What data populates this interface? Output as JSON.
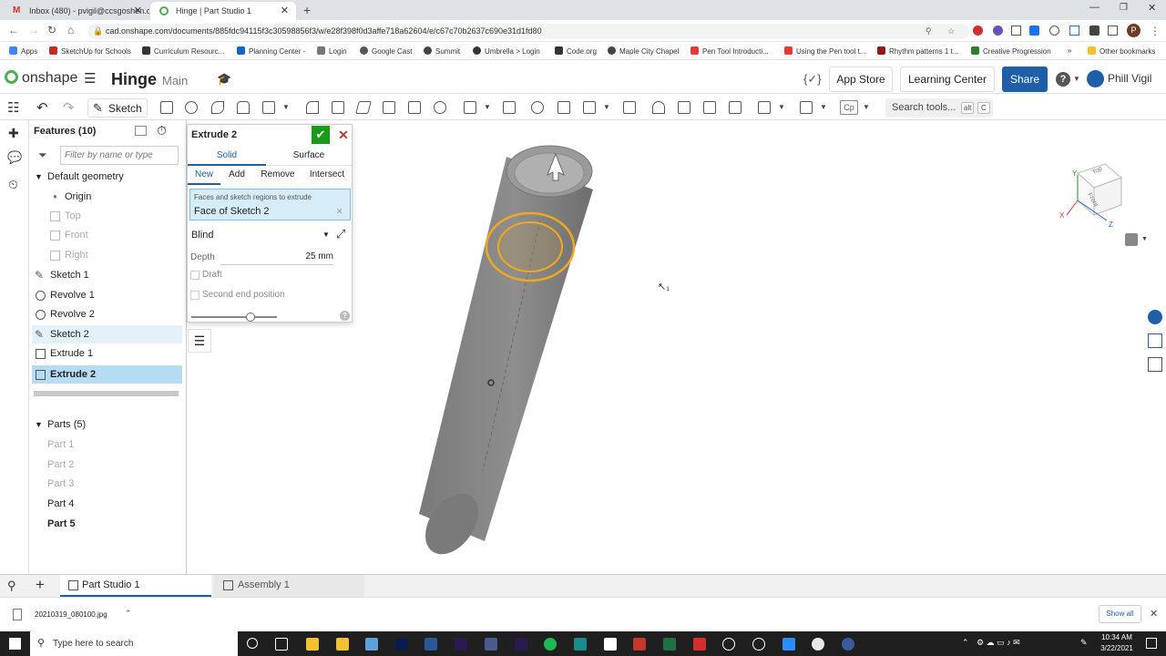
{
  "browser": {
    "tabs": [
      {
        "label": "Inbox (480) - pvigil@ccsgoshen.o",
        "active": false
      },
      {
        "label": "Hinge | Part Studio 1",
        "active": true
      }
    ],
    "url": "cad.onshape.com/documents/885fdc94115f3c30598856f3/w/e28f398f0d3affe718a62604/e/c67c70b2637c690e31d1fd80",
    "bookmarks": [
      "Apps",
      "SketchUp for Schools",
      "Curriculum Resourc...",
      "Planning Center -",
      "Login",
      "Google Cast",
      "Summit",
      "Umbrella > Login",
      "Code.org",
      "Maple City Chapel",
      "Pen Tool Introducti...",
      "Using the Pen tool t...",
      "Rhythm patterns 1 t...",
      "Creative Progression",
      "Other bookmarks"
    ],
    "profile_initial": "P"
  },
  "header": {
    "logo": "onshape",
    "doc_title": "Hinge",
    "branch": "Main",
    "app_store": "App Store",
    "learning_center": "Learning Center",
    "share": "Share",
    "help": "?",
    "user": "Phill Vigil",
    "fx": "{✓}"
  },
  "toolbar": {
    "sketch": "Sketch",
    "search_tools": "Search tools...",
    "shortcut_alt": "alt",
    "shortcut_c": "C",
    "cp": "Cp"
  },
  "features": {
    "header": "Features (10)",
    "filter_placeholder": "Filter by name or type",
    "default_geometry": "Default geometry",
    "planes": [
      "Origin",
      "Top",
      "Front",
      "Right"
    ],
    "items": [
      "Sketch 1",
      "Revolve 1",
      "Revolve 2",
      "Sketch 2",
      "Extrude 1",
      "Extrude 2"
    ],
    "parts_header": "Parts (5)",
    "parts": [
      "Part 1",
      "Part 2",
      "Part 3",
      "Part 4",
      "Part 5"
    ]
  },
  "dialog": {
    "title": "Extrude 2",
    "solid": "Solid",
    "surface": "Surface",
    "ops": [
      "New",
      "Add",
      "Remove",
      "Intersect"
    ],
    "faces_label": "Faces and sketch regions to extrude",
    "faces_value": "Face of Sketch 2",
    "end_type": "Blind",
    "depth_label": "Depth",
    "depth_value": "25 mm",
    "draft": "Draft",
    "second_end": "Second end position",
    "help": "?"
  },
  "viewcube": {
    "top": "Top",
    "front": "Front",
    "x": "X",
    "y": "Y",
    "z": "Z"
  },
  "bottom_tabs": [
    "Part Studio 1",
    "Assembly 1"
  ],
  "download": {
    "file": "20210319_080100.jpg",
    "show_all": "Show all"
  },
  "taskbar": {
    "search": "Type here to search",
    "time": "10:34 AM",
    "date": "3/22/2021"
  },
  "colors": {
    "accent": "#1f5fa8",
    "selection": "#b5dcf3",
    "highlight": "#f0a81c",
    "confirm": "#1a9a1a",
    "cancel": "#c0392b"
  }
}
